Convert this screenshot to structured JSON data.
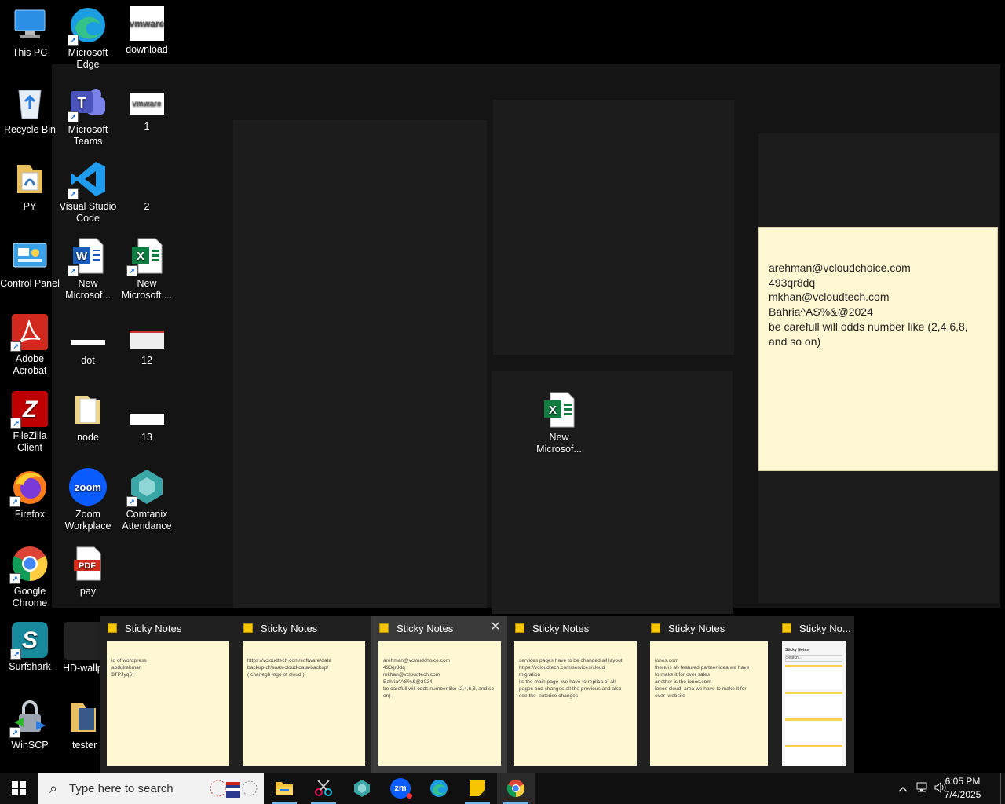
{
  "desktop_icons": [
    {
      "label": "This PC"
    },
    {
      "label": "Microsoft Edge"
    },
    {
      "label": "download"
    },
    {
      "label": "Recycle Bin"
    },
    {
      "label": "Microsoft Teams"
    },
    {
      "label": "1"
    },
    {
      "label": "PY"
    },
    {
      "label": "Visual Studio Code"
    },
    {
      "label": "2"
    },
    {
      "label": "Control Panel"
    },
    {
      "label": "New Microsof..."
    },
    {
      "label": "New Microsoft ..."
    },
    {
      "label": "Adobe Acrobat"
    },
    {
      "label": "dot"
    },
    {
      "label": "12"
    },
    {
      "label": "FileZilla Client"
    },
    {
      "label": "node"
    },
    {
      "label": "13"
    },
    {
      "label": "Firefox"
    },
    {
      "label": "Zoom Workplace"
    },
    {
      "label": "Comtanix Attendance"
    },
    {
      "label": "Google Chrome"
    },
    {
      "label": "pay"
    },
    {
      "label": "Surfshark"
    },
    {
      "label": "HD-wallp"
    },
    {
      "label": "WinSCP"
    },
    {
      "label": "tester"
    },
    {
      "label": "New Microsof..."
    }
  ],
  "icon_text": {
    "vmware": "vmware",
    "vmware_small": "vmware",
    "pdf": "PDF",
    "zoom": "zoom",
    "word": "W",
    "excel": "X",
    "teams": "T"
  },
  "sticky_window": {
    "lines": [
      "arehman@vcloudchoice.com",
      "493qr8dq",
      "mkhan@vcloudtech.com",
      "Bahria^AS%&@2024",
      "be carefull will odds number like (2,4,6,8, and so on)"
    ]
  },
  "previews": [
    {
      "title": "Sticky Notes",
      "lines": [
        "id of wordpress",
        "abdulrehman",
        "$TPJyq5^"
      ]
    },
    {
      "title": "Sticky Notes",
      "lines": [
        "https://vcloudtech.com/software/data",
        "backup-dr/saas-cloud-data-backup/",
        "( chanegh logo of cloud )"
      ]
    },
    {
      "title": "Sticky Notes",
      "lines": [
        "arehman@vcloudchoice.com",
        "493qr8dq",
        "mkhan@vcloudtech.com",
        "Bahria^AS%&@2024",
        "be carefull will odds number like (2,4,6,8, and so on)"
      ]
    },
    {
      "title": "Sticky Notes",
      "lines": [
        "services pages have to be changed all layout",
        "https://vcloudtech.com/services/cloud",
        "migration",
        "its the main page  we have to replica of all",
        "pages and changes all the previous and also",
        "see the  exterise changes"
      ]
    },
    {
      "title": "Sticky Notes",
      "lines": [
        "ionos.com",
        "there is ah featured partner idea we have",
        "to make it for over sales",
        "",
        "another is the ionos.com",
        "ionos cloud  area we have to make it for",
        "over  website"
      ]
    },
    {
      "title": "Sticky No...",
      "lines": [
        "Sticky Notes",
        "Search..."
      ]
    }
  ],
  "active_preview_close": "✕",
  "taskbar": {
    "search_placeholder": "Type here to search",
    "time": "6:05 PM",
    "date": "7/4/2025",
    "zoom_badge": "zm"
  },
  "colors": {
    "sticky_yellow": "#fff8d2",
    "taskbar": "#101010",
    "accent": "#76b9ed"
  }
}
